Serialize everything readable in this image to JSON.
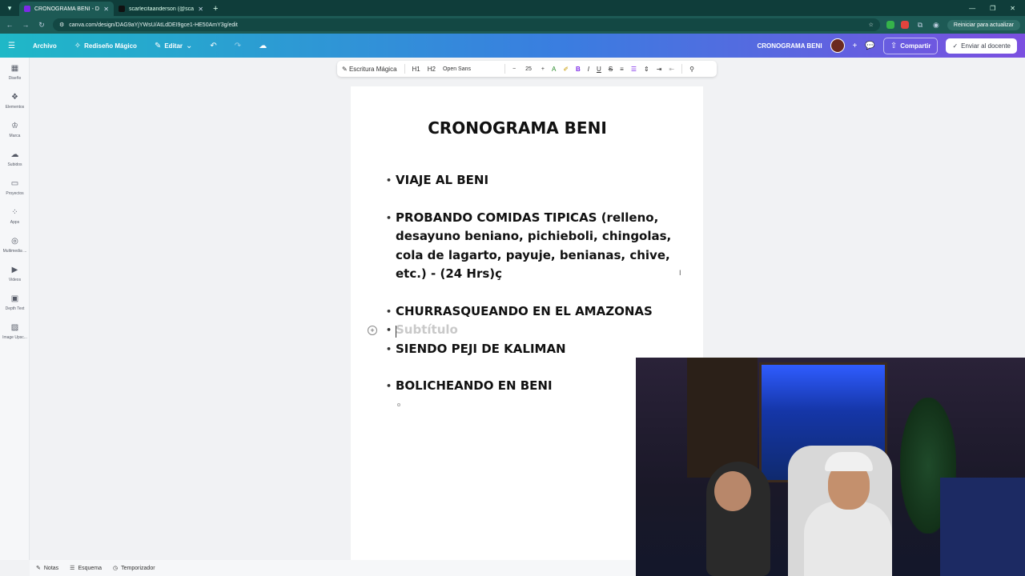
{
  "browser": {
    "tabs": [
      {
        "title": "CRONOGRAMA BENI - Doc",
        "active": true,
        "color": "#7d2ae8"
      },
      {
        "title": "scarlecitaanderson (@scarleh...",
        "active": false,
        "color": "#111111"
      }
    ],
    "url": "canva.com/design/DAG9aYjYWsU/AtLdDEI9gce1-HE50AmY3g/edit",
    "reload_label": "Reiniciar para actualizar"
  },
  "header": {
    "menu_label": "Archivo",
    "magic_label": "Rediseño Mágico",
    "edit_label": "Editar",
    "doc_title": "CRONOGRAMA BENI",
    "share_label": "Compartir",
    "send_label": "Enviar al docente"
  },
  "rail": {
    "items": [
      {
        "label": "Diseño",
        "icon": "layout-icon"
      },
      {
        "label": "Elementos",
        "icon": "shapes-icon"
      },
      {
        "label": "Marca",
        "icon": "crown-icon"
      },
      {
        "label": "Subidos",
        "icon": "cloud-upload-icon"
      },
      {
        "label": "Proyectos",
        "icon": "folder-icon"
      },
      {
        "label": "Apps",
        "icon": "apps-icon"
      },
      {
        "label": "Multimedia ...",
        "icon": "media-icon"
      },
      {
        "label": "Videos",
        "icon": "video-icon"
      },
      {
        "label": "Depth Text",
        "icon": "depth-text-icon"
      },
      {
        "label": "Image Upsc...",
        "icon": "image-upscale-icon"
      }
    ]
  },
  "toolbar": {
    "magic_write": "Escritura Mágica",
    "h1": "H1",
    "h2": "H2",
    "font": "Open Sans",
    "size": "25"
  },
  "document": {
    "title": "CRONOGRAMA BENI",
    "items": [
      {
        "text": "VIAJE AL BENI",
        "gap_after": true
      },
      {
        "text": "PROBANDO COMIDAS TIPICAS (relleno, desayuno beniano, pichieboli, chingolas, cola de lagarto, payuje, benianas, chive, etc.) - (24 Hrs)ç",
        "gap_after": true
      },
      {
        "text": "CHURRASQUEANDO EN EL AMAZONAS",
        "gap_after": false
      },
      {
        "text": "Subtítulo",
        "placeholder": true,
        "gap_after": false
      },
      {
        "text": "SIENDO PEJI DE KALIMAN",
        "gap_after": true
      },
      {
        "text": "BOLICHEANDO EN BENI",
        "gap_after": false
      }
    ]
  },
  "footer": {
    "notes": "Notas",
    "outline": "Esquema",
    "timer": "Temporizador"
  }
}
